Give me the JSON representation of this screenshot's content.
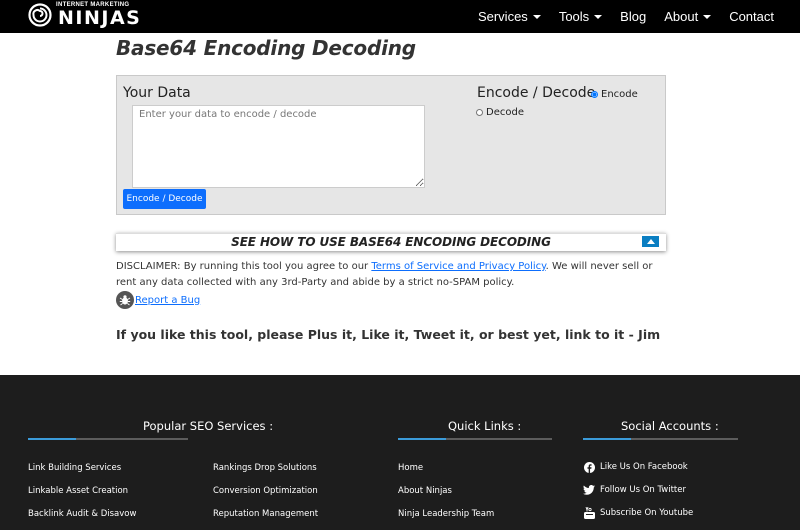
{
  "nav": {
    "logo_small": "INTERNET MARKETING",
    "logo_big": "NINJAS",
    "items": [
      {
        "label": "Services",
        "dropdown": true
      },
      {
        "label": "Tools",
        "dropdown": true
      },
      {
        "label": "Blog",
        "dropdown": false
      },
      {
        "label": "About",
        "dropdown": true
      },
      {
        "label": "Contact",
        "dropdown": false
      }
    ]
  },
  "page": {
    "title": "Base64 Encoding Decoding"
  },
  "tool": {
    "data_label": "Your Data",
    "textarea_placeholder": "Enter your data to encode / decode",
    "textarea_value": "",
    "submit_label": "Encode / Decode",
    "mode_label": "Encode / Decode",
    "mode_options": [
      {
        "label": "Encode",
        "selected": true
      },
      {
        "label": "Decode",
        "selected": false
      }
    ]
  },
  "howto": {
    "text": "SEE HOW TO USE BASE64 ENCODING DECODING",
    "toggle_icon": "arrow-up-icon"
  },
  "disclaimer": {
    "prefix": "DISCLAIMER: By running this tool you agree to our ",
    "link": "Terms of Service and Privacy Policy",
    "suffix": ". We will never sell or rent any data collected with any 3rd-Party and abide by a strict no-SPAM policy."
  },
  "report_bug": "Report a Bug",
  "plus_line": "If you like this tool, please Plus it, Like it, Tweet it, or best yet, link to it - Jim",
  "footer": {
    "popular": {
      "heading": "Popular SEO Services :",
      "col1": [
        "Link Building Services",
        "Linkable Asset Creation",
        "Backlink Audit & Disavow"
      ],
      "col2": [
        "Rankings Drop Solutions",
        "Conversion Optimization",
        "Reputation Management"
      ]
    },
    "quick": {
      "heading": "Quick Links :",
      "links": [
        "Home",
        "About Ninjas",
        "Ninja Leadership Team"
      ]
    },
    "social": {
      "heading": "Social Accounts :",
      "links": [
        {
          "label": "Like Us On Facebook",
          "icon": "facebook-icon"
        },
        {
          "label": "Follow Us On Twitter",
          "icon": "twitter-icon"
        },
        {
          "label": "Subscribe On Youtube",
          "icon": "youtube-icon"
        }
      ]
    },
    "accent_color": "#3b9bd9"
  },
  "colors": {
    "nav_bg": "#000000",
    "button_blue": "#0d6efd",
    "footer_bg": "#1d1d1d"
  }
}
